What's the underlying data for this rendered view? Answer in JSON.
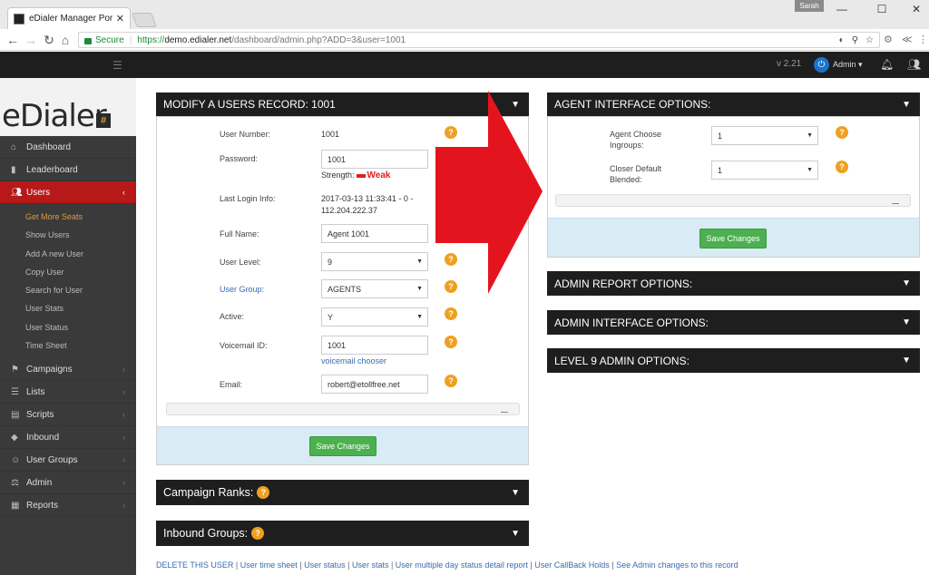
{
  "browser": {
    "tab_title": "eDialer Manager Portal |",
    "tab_close": "✕",
    "profile_name": "Sarah",
    "window_controls": [
      "—",
      "☐",
      "✕"
    ],
    "security_label": "Secure",
    "url_scheme": "https://",
    "url_host": "demo.edialer.net",
    "url_path": "/dashboard/admin.php?ADD=3&user=1001"
  },
  "topbar": {
    "version": "v 2.21",
    "admin_label": "Admin ▾"
  },
  "logo": {
    "text": "eDialer",
    "badge": "#"
  },
  "sidebar": {
    "items": [
      {
        "label": "Dashboard",
        "icon": "home-icon"
      },
      {
        "label": "Leaderboard",
        "icon": "bar-chart-icon"
      },
      {
        "label": "Users",
        "icon": "users-icon"
      },
      {
        "label": "Campaigns",
        "icon": "flag-icon"
      },
      {
        "label": "Lists",
        "icon": "list-icon"
      },
      {
        "label": "Scripts",
        "icon": "document-icon"
      },
      {
        "label": "Inbound",
        "icon": "diamond-icon"
      },
      {
        "label": "User Groups",
        "icon": "user-group-icon"
      },
      {
        "label": "Admin",
        "icon": "admin-icon"
      },
      {
        "label": "Reports",
        "icon": "report-icon"
      }
    ],
    "users_sub": [
      "Get More Seats",
      "Show Users",
      "Add A new User",
      "Copy User",
      "Search for User",
      "User Stats",
      "User Status",
      "Time Sheet"
    ]
  },
  "modify": {
    "title": "MODIFY A USERS RECORD: 1001",
    "user_number_label": "User Number:",
    "user_number": "1001",
    "password_label": "Password:",
    "password": "1001",
    "strength_label": "Strength:",
    "strength_value": "Weak",
    "last_login_label": "Last Login Info:",
    "last_login_line1": "2017-03-13 11:33:41 - 0 -",
    "last_login_line2": "112.204.222.37",
    "full_name_label": "Full Name:",
    "full_name": "Agent 1001",
    "user_level_label": "User Level:",
    "user_level": "9",
    "user_group_label": "User Group:",
    "user_group": "AGENTS",
    "active_label": "Active:",
    "active": "Y",
    "voicemail_label": "Voicemail ID:",
    "voicemail": "1001",
    "voicemail_chooser": "voicemail chooser",
    "email_label": "Email:",
    "email": "robert@etollfree.net",
    "save_label": "Save Changes"
  },
  "agent_options": {
    "title": "AGENT INTERFACE OPTIONS:",
    "ingroups_label_1": "Agent Choose",
    "ingroups_label_2": "Ingroups:",
    "ingroups_value": "1",
    "closer_label_1": "Closer Default",
    "closer_label_2": "Blended:",
    "closer_value": "1",
    "save_label": "Save Changes"
  },
  "collapsed_panels": {
    "admin_report": "ADMIN REPORT OPTIONS:",
    "admin_interface": "ADMIN INTERFACE OPTIONS:",
    "level9": "LEVEL 9 ADMIN OPTIONS:",
    "campaign_ranks": "Campaign Ranks:",
    "inbound_groups": "Inbound Groups:"
  },
  "bottom_links": [
    "DELETE THIS USER",
    "User time sheet",
    "User status",
    "User stats",
    "User multiple day status detail report",
    "User CallBack Holds",
    "See Admin changes to this record"
  ],
  "bottom_separator": " | ",
  "help_glyph": "?",
  "colors": {
    "accent_red": "#b71818",
    "save_green": "#4cb050",
    "help_orange": "#f0a020",
    "dark_header": "#1e1e1e",
    "arrow_red": "#e4141e"
  }
}
